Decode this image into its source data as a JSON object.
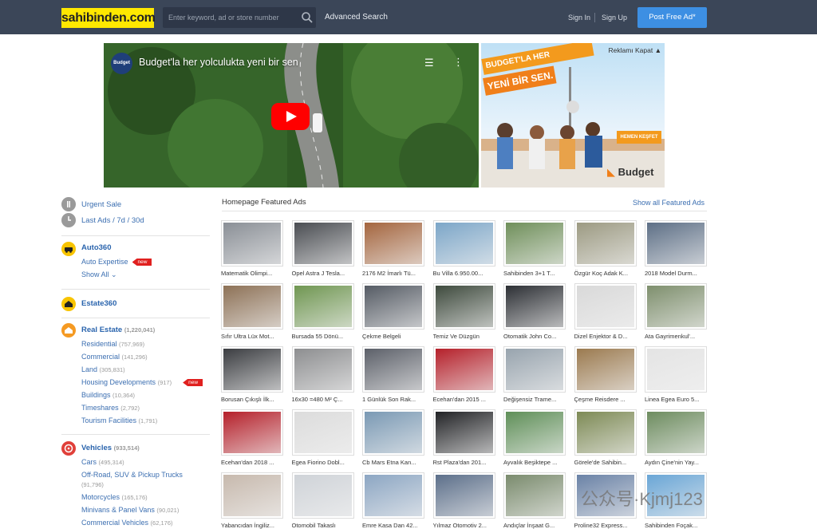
{
  "header": {
    "logo": "sahibinden.com",
    "search_placeholder": "Enter keyword, ad or store number",
    "advanced_search": "Advanced Search",
    "sign_in": "Sign In",
    "sign_up": "Sign Up",
    "post_ad": "Post Free Ad*"
  },
  "banner": {
    "video_logo": "Budget",
    "video_title": "Budget'la her yolculukta yeni bir sen",
    "ad_close": "Reklamı Kapat ▲",
    "ad_slogan_1": "BUDGET'LA HER YOLCULUKTA",
    "ad_slogan_2": "YENİ BİR SEN.",
    "ad_cta": "HEMEN KEŞFET",
    "ad_brand": "Budget"
  },
  "sidebar": {
    "quick": [
      {
        "label": "Urgent Sale"
      },
      {
        "label": "Last Ads / 7d / 30d"
      }
    ],
    "auto360": {
      "label": "Auto360",
      "expertise": "Auto Expertise",
      "new": "new",
      "show_all": "Show All"
    },
    "estate360": {
      "label": "Estate360"
    },
    "real_estate": {
      "label": "Real Estate",
      "count": "(1,220,041)",
      "items": [
        {
          "label": "Residential",
          "count": "(757,969)"
        },
        {
          "label": "Commercial",
          "count": "(141,296)"
        },
        {
          "label": "Land",
          "count": "(305,831)"
        },
        {
          "label": "Housing Developments",
          "count": "(917)",
          "new": "new"
        },
        {
          "label": "Buildings",
          "count": "(10,364)"
        },
        {
          "label": "Timeshares",
          "count": "(2,792)"
        },
        {
          "label": "Tourism Facilities",
          "count": "(1,791)"
        }
      ]
    },
    "vehicles": {
      "label": "Vehicles",
      "count": "(933,514)",
      "items": [
        {
          "label": "Cars",
          "count": "(495,314)"
        },
        {
          "label": "Off-Road, SUV & Pickup Trucks",
          "count": "(91,796)"
        },
        {
          "label": "Motorcycles",
          "count": "(165,176)"
        },
        {
          "label": "Minivans & Panel Vans",
          "count": "(90,021)"
        },
        {
          "label": "Commercial Vehicles",
          "count": "(62,176)"
        }
      ]
    }
  },
  "featured": {
    "title": "Homepage Featured Ads",
    "show_all": "Show all Featured Ads",
    "ads": [
      {
        "caption": "Matematik Olimpi...",
        "color": "#8a8f96"
      },
      {
        "caption": "Opel Astra J Tesla...",
        "color": "#4a4d52"
      },
      {
        "caption": "2176 M2 İmarlı Tü...",
        "color": "#a4653e"
      },
      {
        "caption": "Bu Villa 6.950.00...",
        "color": "#7ca6c8"
      },
      {
        "caption": "Sahibinden 3+1 T...",
        "color": "#6f8f5a"
      },
      {
        "caption": "Özgür Koç Adak K...",
        "color": "#9c9a82"
      },
      {
        "caption": "2018 Model Durm...",
        "color": "#5d6f86"
      },
      {
        "caption": "Sıfır Ultra Lüx Mot...",
        "color": "#8d7156"
      },
      {
        "caption": "Bursada 55 Dönü...",
        "color": "#6f9651"
      },
      {
        "caption": "Çekme Belgeli",
        "color": "#555b64"
      },
      {
        "caption": "Temiz Ve Düzgün",
        "color": "#3e4a3d"
      },
      {
        "caption": "Otomatik John Co...",
        "color": "#2c2f34"
      },
      {
        "caption": "Dizel Enjektor & D...",
        "color": "#d9d9d9"
      },
      {
        "caption": "Ata Gayrimenkul'...",
        "color": "#7e8f6d"
      },
      {
        "caption": "Borusan Çıkışlı İlk...",
        "color": "#3b3d41"
      },
      {
        "caption": "16x30 =480 M² Ç...",
        "color": "#8d8e90"
      },
      {
        "caption": "1 Günlük Son Rak...",
        "color": "#5c6069"
      },
      {
        "caption": "Ecehan'dan 2015 ...",
        "color": "#b5202a"
      },
      {
        "caption": "Değişensiz Trame...",
        "color": "#98a4ae"
      },
      {
        "caption": "Çeşme Reisdere ...",
        "color": "#9b7a4f"
      },
      {
        "caption": "Linea Egea Euro 5...",
        "color": "#e4e4e4"
      },
      {
        "caption": "Ecehan'dan 2018 ...",
        "color": "#b5202a"
      },
      {
        "caption": "Egea Fiorino Dobl...",
        "color": "#dcdcdc"
      },
      {
        "caption": "Cb Mars Etna Kan...",
        "color": "#7a99b4"
      },
      {
        "caption": "Rst Plaza'dan 201...",
        "color": "#222326"
      },
      {
        "caption": "Ayvalık Beşiktepe ...",
        "color": "#5f8f58"
      },
      {
        "caption": "Görele'de Sahibin...",
        "color": "#7d8a55"
      },
      {
        "caption": "Aydın Çine'nin Yay...",
        "color": "#6d8c5f"
      },
      {
        "caption": "Yabancıdan İngiliz...",
        "color": "#c7b9ad"
      },
      {
        "caption": "Otomobil Takaslı",
        "color": "#cfd3d8"
      },
      {
        "caption": "Emre Kasa Dan 42...",
        "color": "#8ca6c3"
      },
      {
        "caption": "Yılmaz Otomotiv 2...",
        "color": "#5c6f8a"
      },
      {
        "caption": "Andıçlar İnşaat G...",
        "color": "#7a8b6d"
      },
      {
        "caption": "Proline32 Express...",
        "color": "#6a82a6"
      },
      {
        "caption": "Sahibinden Foçak...",
        "color": "#6aa6d6"
      }
    ]
  },
  "watermark": "公众号·Kjmj123"
}
